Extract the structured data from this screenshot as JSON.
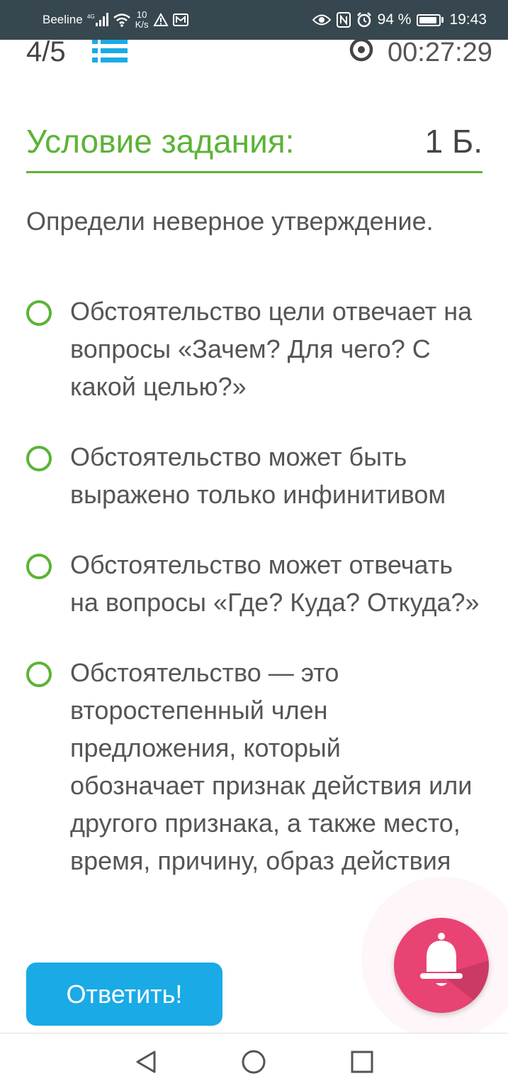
{
  "status_bar": {
    "carrier": "Beeline",
    "network_badge": "4G",
    "net_speed_value": "10",
    "net_speed_unit": "K/s",
    "battery_percent": "94 %",
    "time": "19:43",
    "icons": [
      "signal-icon",
      "wifi-icon",
      "warning-icon",
      "mail-icon",
      "eye-icon",
      "nfc-icon",
      "alarm-icon",
      "battery-icon"
    ]
  },
  "header": {
    "progress": "4/5",
    "timer": "00:27:29",
    "icons": [
      "question-list-icon",
      "timer-icon"
    ]
  },
  "task": {
    "heading": "Условие задания:",
    "points": "1 Б.",
    "question": "Определи неверное утверждение."
  },
  "options": [
    {
      "text": "Обстоятельство цели отвечает на вопросы «Зачем? Для чего? С какой целью?»"
    },
    {
      "text": "Обстоятельство может быть выражено только инфинитивом"
    },
    {
      "text": "Обстоятельство может отвечать на вопросы «Где? Куда? Откуда?»"
    },
    {
      "text": "Обстоятельство — это второстепенный член предложения, который обозначает признак действия или другого признака, а также место, время, причину, образ действия"
    }
  ],
  "actions": {
    "answer_label": "Ответить!",
    "notification_icon": "bell-icon"
  },
  "nav": {
    "icons": [
      "back-icon",
      "home-icon",
      "recents-icon"
    ]
  },
  "colors": {
    "accent_green": "#5cb336",
    "button_blue": "#1aaae6",
    "bell_pink": "#e84373",
    "status_bar": "#37474f"
  }
}
